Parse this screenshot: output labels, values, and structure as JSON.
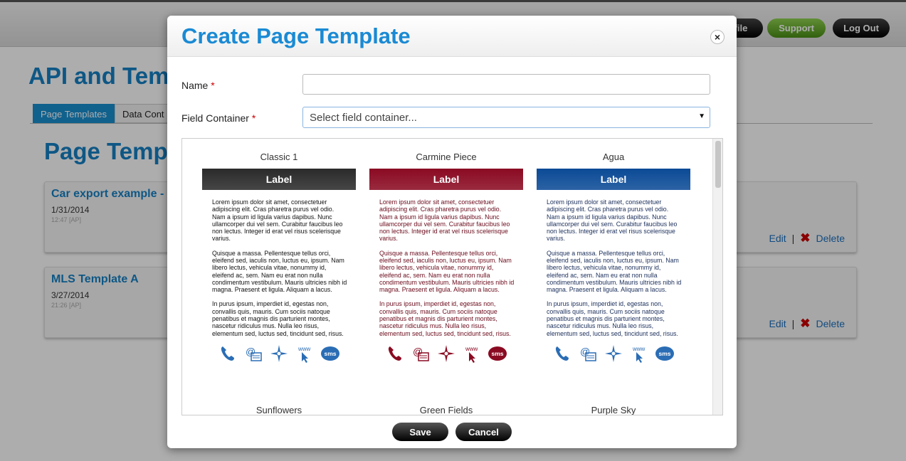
{
  "header": {
    "profile_label": "file",
    "support_label": "Support",
    "logout_label": "Log Out"
  },
  "page": {
    "title": "API and Tem",
    "tabs": [
      {
        "label": "Page Templates"
      },
      {
        "label": "Data Cont"
      }
    ],
    "section_title": "Page Temp",
    "templates": [
      {
        "title": "Car export example -",
        "date": "1/31/2014",
        "time": "12:47 [AP]",
        "edit": "Edit",
        "sep": "|",
        "delete": "Delete"
      },
      {
        "title": "MLS Template A",
        "date": "3/27/2014",
        "time": "21:26 [AP]",
        "edit": "Edit",
        "sep": "|",
        "delete": "Delete"
      }
    ]
  },
  "modal": {
    "title": "Create Page Template",
    "close_symbol": "×",
    "name_label": "Name",
    "required_mark": "*",
    "field_container_label": "Field Container",
    "field_container_placeholder": "Select field container...",
    "templates": [
      {
        "name": "Classic 1",
        "band_label": "Label",
        "band_color": "#2a2a2a",
        "text_color": "#111111",
        "icon_color": "#2a6db5"
      },
      {
        "name": "Carmine Piece",
        "band_label": "Label",
        "band_color": "#8a0a22",
        "text_color": "#6a0a1a",
        "icon_color": "#8a0a22"
      },
      {
        "name": "Agua",
        "band_label": "Label",
        "band_color": "#0b4a96",
        "text_color": "#1a2e5a",
        "icon_color": "#2a6db5"
      }
    ],
    "body_paragraphs": [
      "Lorem ipsum dolor sit amet, consectetuer adipiscing elit. Cras pharetra purus vel odio. Nam a ipsum id ligula varius dapibus. Nunc ullamcorper dui vel sem. Curabitur faucibus leo non lectus. Integer id erat vel risus scelerisque varius.",
      "Quisque a massa. Pellentesque tellus orci, eleifend sed, iaculis non, luctus eu, ipsum. Nam libero lectus, vehicula vitae, nonummy id, eleifend ac, sem. Nam eu erat non nulla condimentum vestibulum. Mauris ultricies nibh id magna. Praesent et ligula. Aliquam a lacus.",
      "In purus ipsum, imperdiet id, egestas non, convallis quis, mauris. Cum sociis natoque penatibus et magnis dis parturient montes, nascetur ridiculus mus. Nulla leo risus, elementum sed, luctus sed, tincidunt sed, risus."
    ],
    "icon_labels": {
      "web": "www",
      "sms": "sms"
    },
    "row2_names": [
      "Sunflowers",
      "Green Fields",
      "Purple Sky"
    ],
    "save_label": "Save",
    "cancel_label": "Cancel"
  },
  "colors": {
    "accent": "#1a8ad4",
    "support_green": "#5fa624",
    "delete_red": "#cc0000"
  }
}
